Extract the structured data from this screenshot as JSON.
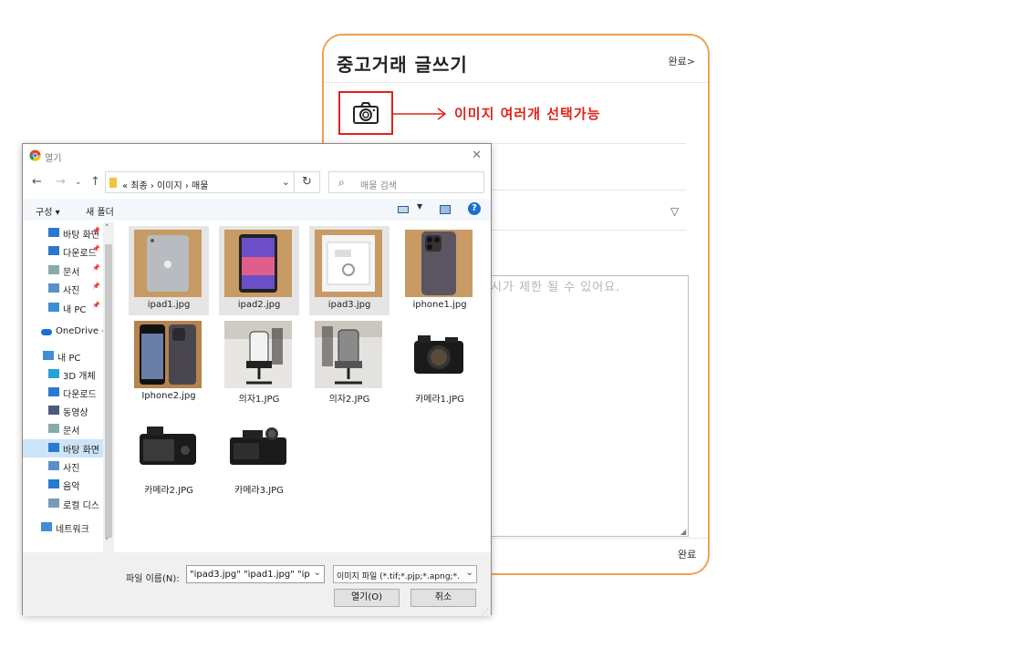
{
  "form": {
    "title": "중고거래 글쓰기",
    "done_top": "완료>",
    "annotation": "이미지 여러개 선택가능",
    "content_placeholder": "시가 제한 될 수 있어요.",
    "done_bottom": "완료",
    "highlight_color": "#e0221c",
    "border_color": "#f0a050"
  },
  "dialog": {
    "title": "열기",
    "address": "«  최종  ›  이미지  ›  매물",
    "search_placeholder": "매물 검색",
    "toolbar": {
      "organize": "구성 ▾",
      "new_folder": "새 폴더"
    },
    "nav_items": [
      {
        "label": "바탕 화면",
        "icon": "desktop-icon",
        "pinned": true
      },
      {
        "label": "다운로드",
        "icon": "download-icon",
        "pinned": true
      },
      {
        "label": "문서",
        "icon": "document-icon",
        "pinned": true
      },
      {
        "label": "사진",
        "icon": "picture-icon",
        "pinned": true
      },
      {
        "label": "내 PC",
        "icon": "pc-icon",
        "pinned": true
      },
      {
        "label": "OneDrive -",
        "icon": "onedrive-icon",
        "pinned": false
      },
      {
        "label": "내 PC",
        "icon": "pc-icon",
        "pinned": false
      },
      {
        "label": "3D 개체",
        "icon": "3d-objects-icon",
        "pinned": false
      },
      {
        "label": "다운로드",
        "icon": "download-icon",
        "pinned": false
      },
      {
        "label": "동영상",
        "icon": "video-icon",
        "pinned": false
      },
      {
        "label": "문서",
        "icon": "document-icon",
        "pinned": false
      },
      {
        "label": "바탕 화면",
        "icon": "desktop-icon",
        "pinned": false,
        "selected": true
      },
      {
        "label": "사진",
        "icon": "picture-icon",
        "pinned": false
      },
      {
        "label": "음악",
        "icon": "music-icon",
        "pinned": false
      },
      {
        "label": "로컬 디스",
        "icon": "disk-icon",
        "pinned": false
      },
      {
        "label": "네트워크",
        "icon": "network-icon",
        "pinned": false
      }
    ],
    "files": [
      {
        "name": "ipad1.jpg",
        "selected": true,
        "thumb": "ipad-back"
      },
      {
        "name": "ipad2.jpg",
        "selected": true,
        "thumb": "ipad-front"
      },
      {
        "name": "ipad3.jpg",
        "selected": true,
        "thumb": "ipad-box"
      },
      {
        "name": "iphone1.jpg",
        "selected": false,
        "thumb": "iphone-back"
      },
      {
        "name": "Iphone2.jpg",
        "selected": false,
        "thumb": "iphone-pair"
      },
      {
        "name": "의자1.JPG",
        "selected": false,
        "thumb": "chair-white"
      },
      {
        "name": "의자2.JPG",
        "selected": false,
        "thumb": "chair-grey"
      },
      {
        "name": "카메라1.JPG",
        "selected": false,
        "thumb": "camera-front"
      },
      {
        "name": "카메라2.JPG",
        "selected": false,
        "thumb": "camera-back"
      },
      {
        "name": "카메라3.JPG",
        "selected": false,
        "thumb": "camera-top"
      }
    ],
    "file_name_label": "파일 이름(N):",
    "file_name_value": "\"ipad3.jpg\" \"ipad1.jpg\" \"ipad",
    "file_type_value": "이미지 파일 (*.tif;*.pjp;*.apng;*.",
    "open_label": "열기(O)",
    "cancel_label": "취소"
  }
}
